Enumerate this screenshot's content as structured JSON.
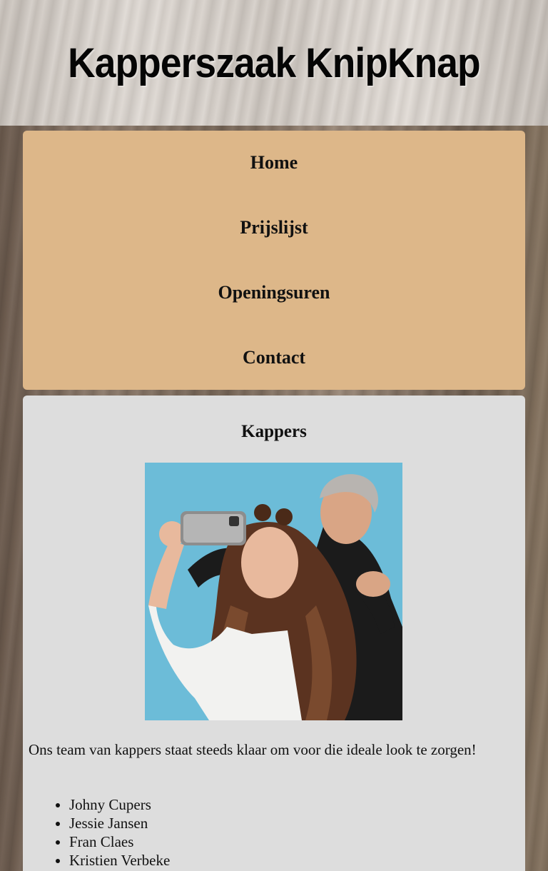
{
  "header": {
    "title": "Kapperszaak KnipKnap"
  },
  "nav": {
    "items": [
      {
        "label": "Home"
      },
      {
        "label": "Prijslijst"
      },
      {
        "label": "Openingsuren"
      },
      {
        "label": "Contact"
      }
    ]
  },
  "main": {
    "heading": "Kappers",
    "photo_alt": "Kapper met klant die een selfie neemt",
    "intro": "Ons team van kappers staat steeds klaar om voor die ideale look te zorgen!",
    "team": [
      {
        "name": "Johny Cupers"
      },
      {
        "name": "Jessie Jansen"
      },
      {
        "name": "Fran Claes"
      },
      {
        "name": "Kristien Verbeke"
      }
    ]
  },
  "colors": {
    "nav_bg": "#ddb789",
    "content_bg": "#dddddd",
    "photo_bg": "#69b9d6"
  }
}
